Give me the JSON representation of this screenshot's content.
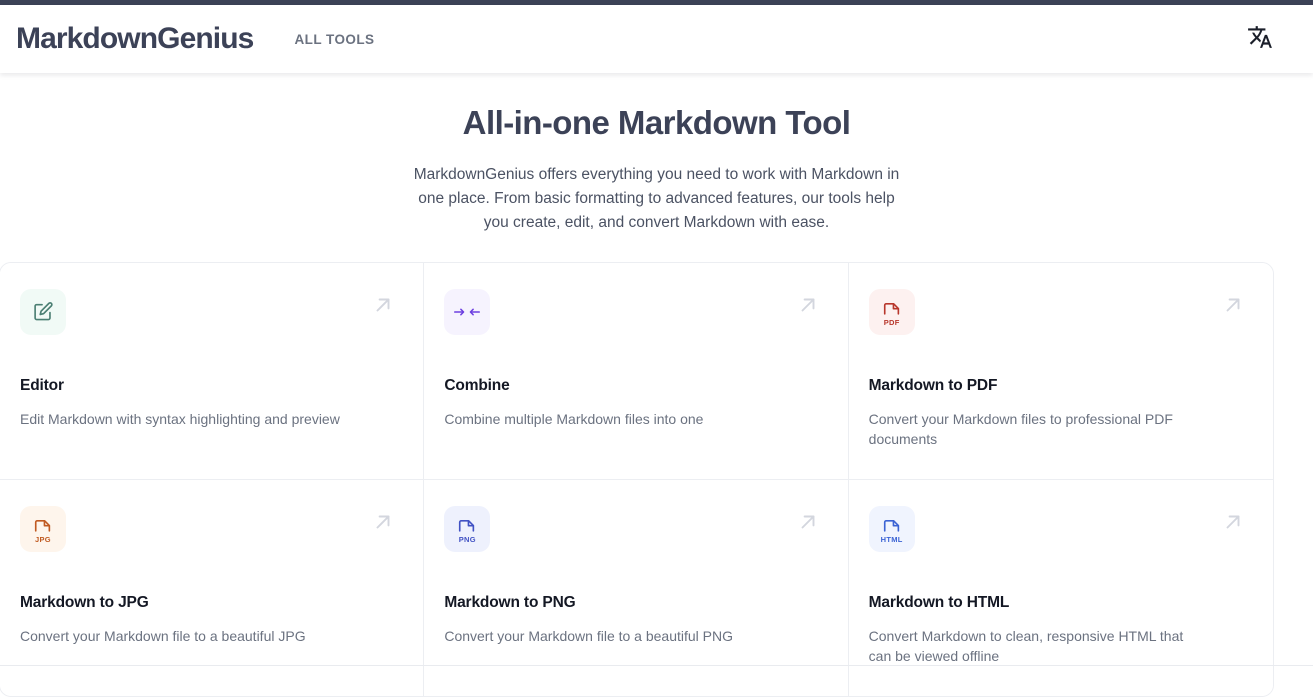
{
  "header": {
    "brand": "MarkdownGenius",
    "nav_all_tools": "ALL TOOLS",
    "language_icon": "translate-icon"
  },
  "hero": {
    "title": "All-in-one Markdown Tool",
    "subtitle": "MarkdownGenius offers everything you need to work with Markdown in one place. From basic formatting to advanced features, our tools help you create, edit, and convert Markdown with ease."
  },
  "tools": [
    {
      "title": "Editor",
      "description": "Edit Markdown with syntax highlighting and preview",
      "icon": "pencil-square-icon",
      "icon_kind": "pencil",
      "icon_bg": "#f1faf6",
      "icon_fg": "#4b7f73",
      "badge": ""
    },
    {
      "title": "Combine",
      "description": "Combine multiple Markdown files into one",
      "icon": "merge-arrows-icon",
      "icon_kind": "merge",
      "icon_bg": "#f6f3fe",
      "icon_fg": "#6d3fe0",
      "badge": ""
    },
    {
      "title": "Markdown to PDF",
      "description": "Convert your Markdown files to professional PDF documents",
      "icon": "pdf-file-icon",
      "icon_kind": "file",
      "icon_bg": "#fdf1f0",
      "icon_fg": "#b8372c",
      "badge": "PDF"
    },
    {
      "title": "Markdown to JPG",
      "description": "Convert your Markdown file to a beautiful JPG",
      "icon": "jpg-file-icon",
      "icon_kind": "file",
      "icon_bg": "#fef5ec",
      "icon_fg": "#c05a21",
      "badge": "JPG"
    },
    {
      "title": "Markdown to PNG",
      "description": "Convert your Markdown file to a beautiful PNG",
      "icon": "png-file-icon",
      "icon_kind": "file",
      "icon_bg": "#eef1fd",
      "icon_fg": "#4152c4",
      "badge": "PNG"
    },
    {
      "title": "Markdown to HTML",
      "description": "Convert Markdown to clean, responsive HTML that can be viewed offline",
      "icon": "html-file-icon",
      "icon_kind": "file",
      "icon_bg": "#f0f4fe",
      "icon_fg": "#3b63d4",
      "badge": "HTML"
    }
  ],
  "colors": {
    "brand_navy": "#3c4257",
    "text_muted": "#6b7280",
    "border": "#eceef2",
    "arrow": "#d3d6de"
  }
}
